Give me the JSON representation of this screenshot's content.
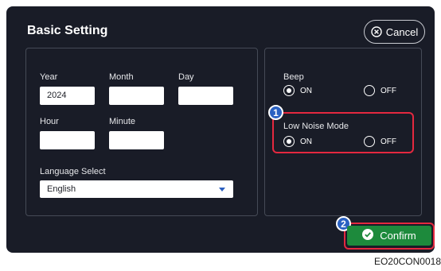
{
  "header": {
    "title": "Basic Setting",
    "cancel_label": "Cancel"
  },
  "datetime": {
    "year_label": "Year",
    "year_value": "2024",
    "month_label": "Month",
    "month_value": "",
    "day_label": "Day",
    "day_value": "",
    "hour_label": "Hour",
    "hour_value": "",
    "minute_label": "Minute",
    "minute_value": ""
  },
  "language": {
    "label": "Language Select",
    "selected": "English"
  },
  "beep": {
    "label": "Beep",
    "on_label": "ON",
    "off_label": "OFF",
    "selected": "ON"
  },
  "low_noise": {
    "label": "Low Noise Mode",
    "on_label": "ON",
    "off_label": "OFF",
    "selected": "ON"
  },
  "callouts": {
    "one": "1",
    "two": "2"
  },
  "footer": {
    "confirm_label": "Confirm",
    "caption": "EO20CON0018"
  },
  "colors": {
    "background": "#191c27",
    "highlight": "#e4283f",
    "badge": "#2a61c2",
    "confirm": "#1d8a3c"
  },
  "icons": {
    "cancel": "close-circle-icon",
    "confirm": "check-circle-icon",
    "dropdown": "caret-down-icon"
  }
}
